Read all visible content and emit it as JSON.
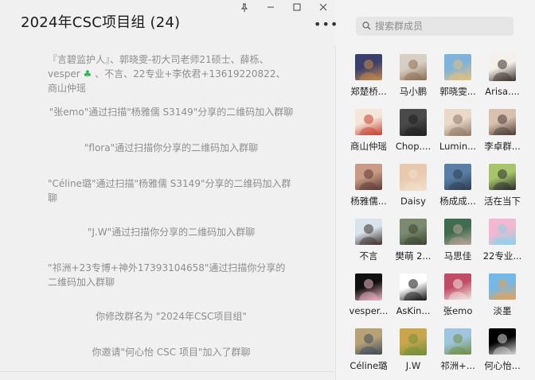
{
  "chat": {
    "title": "2024年CSC项目组 (24)",
    "more_label": "•••"
  },
  "window": {
    "pin_icon": "pin-icon",
    "minimize_icon": "minimize-icon",
    "maximize_icon": "maximize-icon",
    "close_icon": "close-icon"
  },
  "messages": [
    {
      "text_a": "『言碧监护人』、郭晓雯-初大司老师21硕士、薛栎、vesper",
      "text_b": "、不言、22专业+李依君+13619220822、商山仲瑶",
      "clover": "♣"
    },
    {
      "text": "\"张emo\"通过扫描\"杨雅儒 S3149\"分享的二维码加入群聊"
    },
    {
      "text": "\"flora\"通过扫描你分享的二维码加入群聊"
    },
    {
      "text": "\"Céline璐\"通过扫描\"杨雅儒 S3149\"分享的二维码加入群聊"
    },
    {
      "text": "\"J.W\"通过扫描你分享的二维码加入群聊"
    },
    {
      "text": "\"祁洲+23专博+神外17393104658\"通过扫描你分享的二维码加入群聊"
    },
    {
      "text": "你修改群名为 \"2024年CSC项目组\""
    },
    {
      "text": "你邀请\"何心怡 CSC 项目\"加入了群聊"
    }
  ],
  "search": {
    "placeholder": "搜索群成员",
    "icon": "search-icon"
  },
  "members": [
    {
      "name": "郑楚桥...",
      "colors": [
        "#3a3f6b",
        "#c98a4a"
      ]
    },
    {
      "name": "马小鹏",
      "colors": [
        "#d8cfc4",
        "#8b6d52"
      ]
    },
    {
      "name": "郭晓雯...",
      "colors": [
        "#7fb3d9",
        "#e6c07a"
      ]
    },
    {
      "name": "Arisa....",
      "colors": [
        "#f4f0ea",
        "#3a2d28"
      ]
    },
    {
      "name": "商山仲瑶",
      "colors": [
        "#f6e6d9",
        "#c43f2e"
      ]
    },
    {
      "name": "Chop....",
      "colors": [
        "#4a4a4a",
        "#1e1e1e"
      ]
    },
    {
      "name": "Lumin...",
      "colors": [
        "#ead9c9",
        "#8f7764"
      ]
    },
    {
      "name": "李卓群...",
      "colors": [
        "#d9c1b0",
        "#4c3b33"
      ]
    },
    {
      "name": "杨雅儒...",
      "colors": [
        "#c99a86",
        "#5c3a35"
      ]
    },
    {
      "name": "Daisy",
      "colors": [
        "#e9c9ae",
        "#f1e0cf"
      ]
    },
    {
      "name": "杨成成...",
      "colors": [
        "#5a7ea6",
        "#2d3d52"
      ]
    },
    {
      "name": "活在当下",
      "colors": [
        "#a7c66b",
        "#2b2b2b"
      ]
    },
    {
      "name": "不言",
      "colors": [
        "#d8e3ec",
        "#3c2f2a"
      ]
    },
    {
      "name": "樊萌 2...",
      "colors": [
        "#7a8a6e",
        "#3b4433"
      ]
    },
    {
      "name": "马思佳",
      "colors": [
        "#3f6b4e",
        "#b9a59a"
      ]
    },
    {
      "name": "22专业...",
      "colors": [
        "#f2b8cf",
        "#8ad3ea"
      ]
    },
    {
      "name": "vesper...",
      "colors": [
        "#101010",
        "#f0b7c6"
      ]
    },
    {
      "name": "AsKin...",
      "colors": [
        "#ffffff",
        "#111111"
      ]
    },
    {
      "name": "张emo",
      "colors": [
        "#c24b66",
        "#f2e7e3"
      ]
    },
    {
      "name": "淡墨",
      "colors": [
        "#73b8e6",
        "#e2a35a"
      ]
    },
    {
      "name": "Céline璐",
      "colors": [
        "#b7a278",
        "#3f4b5a"
      ]
    },
    {
      "name": "J.W",
      "colors": [
        "#c9a64b",
        "#6e8f3a"
      ]
    },
    {
      "name": "祁洲+...",
      "colors": [
        "#9fc5e0",
        "#6f8f3f"
      ]
    },
    {
      "name": "何心怡...",
      "colors": [
        "#000000",
        "#d9d9d9"
      ]
    }
  ]
}
